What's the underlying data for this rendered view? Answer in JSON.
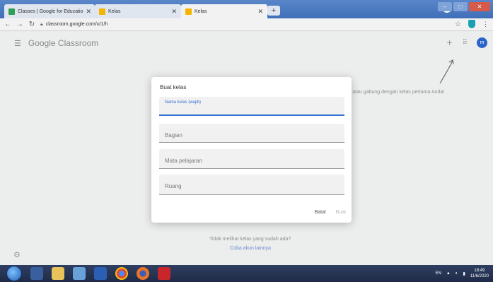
{
  "browser": {
    "tabs": [
      {
        "title": "Classes | Google for Educatio",
        "favicon": "classroom-favicon",
        "active": false
      },
      {
        "title": "Kelas",
        "favicon": "classroom-favicon",
        "active": false
      },
      {
        "title": "Kelas",
        "favicon": "classroom-favicon",
        "active": true
      }
    ],
    "tab_close": "✕",
    "new_tab": "+",
    "url": "classroom.google.com/u/1/h"
  },
  "app": {
    "brand": "Google Classroom",
    "account_initial": "m",
    "hint_text": "r atau gabung dengan kelas pertama Anda!",
    "empty_text": "Tidak melihat kelas yang sudah ada?",
    "empty_link": "Coba akun lainnya"
  },
  "dialog": {
    "title": "Buat kelas",
    "fields": {
      "name": "Nama kelas (wajib)",
      "section": "Bagian",
      "subject": "Mata pelajaran",
      "room": "Ruang"
    },
    "cancel": "Batal",
    "create": "Buat"
  },
  "taskbar": {
    "lang": "EN",
    "time": "18:49",
    "date": "11/6/2020"
  },
  "colors": {
    "accent": "#3470d4",
    "tabstrip": "#4a79c0",
    "taskbar": "#26345a"
  }
}
